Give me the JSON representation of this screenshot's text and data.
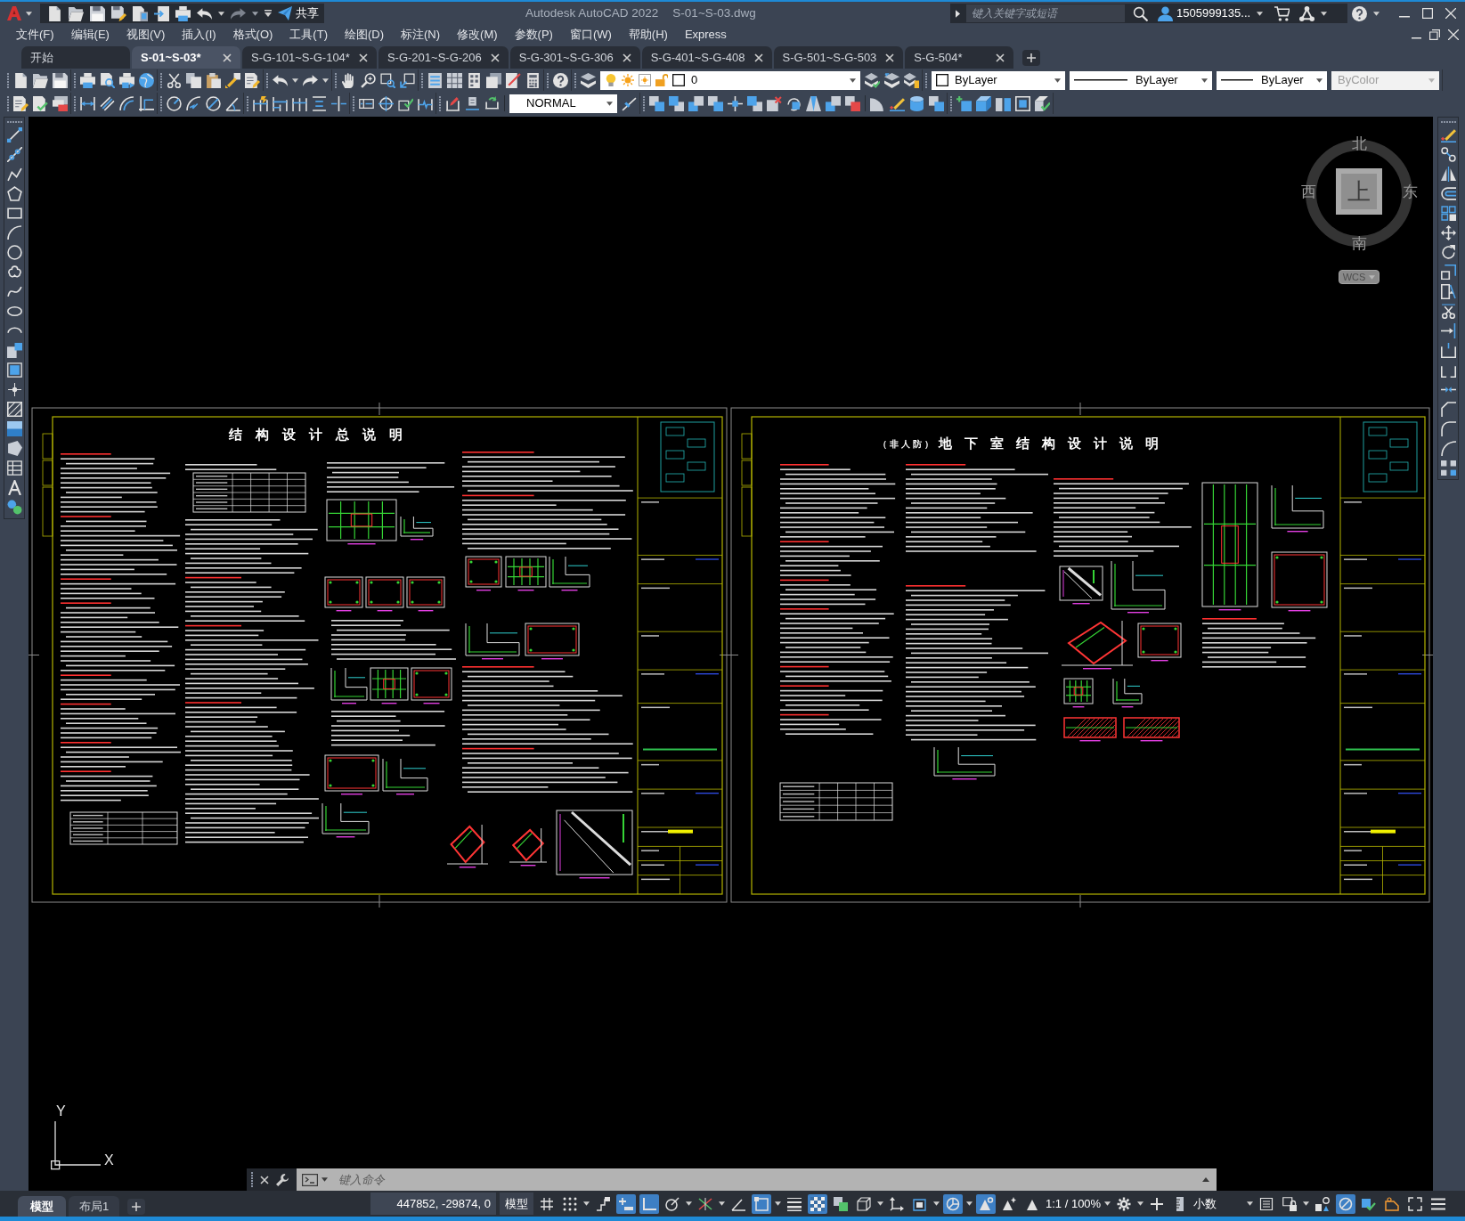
{
  "title_bar": {
    "redo": {
      "disabled": true
    },
    "share_label": "共享",
    "app_title": "Autodesk AutoCAD 2022",
    "file_name": "S-01~S-03.dwg",
    "search": {
      "placeholder": "键入关键字或短语"
    },
    "user_name": "1505999135..."
  },
  "menu": [
    "文件(F)",
    "编辑(E)",
    "视图(V)",
    "插入(I)",
    "格式(O)",
    "工具(T)",
    "绘图(D)",
    "标注(N)",
    "修改(M)",
    "参数(P)",
    "窗口(W)",
    "帮助(H)",
    "Express"
  ],
  "file_tabs": [
    {
      "label": "开始",
      "selected": false,
      "closable": false
    },
    {
      "label": "S-01~S-03*",
      "selected": true,
      "closable": true
    },
    {
      "label": "S-G-101~S-G-104*",
      "selected": false,
      "closable": true
    },
    {
      "label": "S-G-201~S-G-206",
      "selected": false,
      "closable": true
    },
    {
      "label": "S-G-301~S-G-306",
      "selected": false,
      "closable": true
    },
    {
      "label": "S-G-401~S-G-408",
      "selected": false,
      "closable": true
    },
    {
      "label": "S-G-501~S-G-503",
      "selected": false,
      "closable": true
    },
    {
      "label": "S-G-504*",
      "selected": false,
      "closable": true
    }
  ],
  "properties_toolbar": {
    "layer": "0",
    "color_control": "ByLayer",
    "linetype": "ByLayer",
    "lineweight": "ByLayer",
    "plot_style": {
      "value": "ByColor",
      "disabled": true
    }
  },
  "dimension_toolbar": {
    "dim_style": "NORMAL"
  },
  "viewcube": {
    "north": "北",
    "west": "西",
    "east": "东",
    "south": "南",
    "face": "上",
    "coordinate_system": "WCS"
  },
  "sheets": [
    {
      "title": "结构设计总说明"
    },
    {
      "title_note": "（非人防）",
      "title": "地下室结构设计说明"
    }
  ],
  "ucs_icon": {
    "y_label": "Y",
    "x_label": "X"
  },
  "command_line": {
    "placeholder": "键入命令"
  },
  "layout_tabs": [
    {
      "label": "模型",
      "selected": true
    },
    {
      "label": "布局1",
      "selected": false
    }
  ],
  "status_bar": {
    "items": [
      {
        "kind": "coordinates",
        "text": "447852, -29874, 0"
      },
      {
        "kind": "model_space",
        "text": "模型"
      },
      {
        "kind": "grid",
        "on": false
      },
      {
        "kind": "snap",
        "on": false,
        "menu": true
      },
      {
        "kind": "infer_constraints",
        "on": false
      },
      {
        "kind": "dynamic_input",
        "on": true
      },
      {
        "kind": "ortho",
        "on": true
      },
      {
        "kind": "polar",
        "on": false,
        "menu": true
      },
      {
        "kind": "isodraft",
        "on": false,
        "menu": true
      },
      {
        "kind": "object_snap_tracking",
        "on": false
      },
      {
        "kind": "object_snap",
        "on": true,
        "menu": true
      },
      {
        "kind": "lineweight",
        "on": false
      },
      {
        "kind": "transparency",
        "on": true
      },
      {
        "kind": "selection_cycling",
        "on": false
      },
      {
        "kind": "object_snap_3d",
        "on": false,
        "menu": true
      },
      {
        "kind": "dynamic_ucs",
        "on": false
      },
      {
        "kind": "selection_filter",
        "on": false,
        "menu": true
      },
      {
        "kind": "gizmo",
        "on": true,
        "menu": true
      },
      {
        "kind": "annotation_visibility",
        "on": true
      },
      {
        "kind": "auto_scale",
        "on": false
      },
      {
        "kind": "annotation_scale",
        "text": "1:1 / 100%",
        "menu": true
      },
      {
        "kind": "workspace",
        "menu": true
      },
      {
        "kind": "annotation_monitor",
        "on": false
      },
      {
        "kind": "units",
        "text": "小数",
        "menu": true
      },
      {
        "kind": "quick_properties",
        "on": false
      },
      {
        "kind": "lock_ui",
        "menu": true
      },
      {
        "kind": "isolate"
      },
      {
        "kind": "graphics_performance",
        "on": true
      },
      {
        "kind": "check_tool"
      },
      {
        "kind": "tag_tool"
      },
      {
        "kind": "clean_screen"
      },
      {
        "kind": "customization"
      }
    ]
  }
}
